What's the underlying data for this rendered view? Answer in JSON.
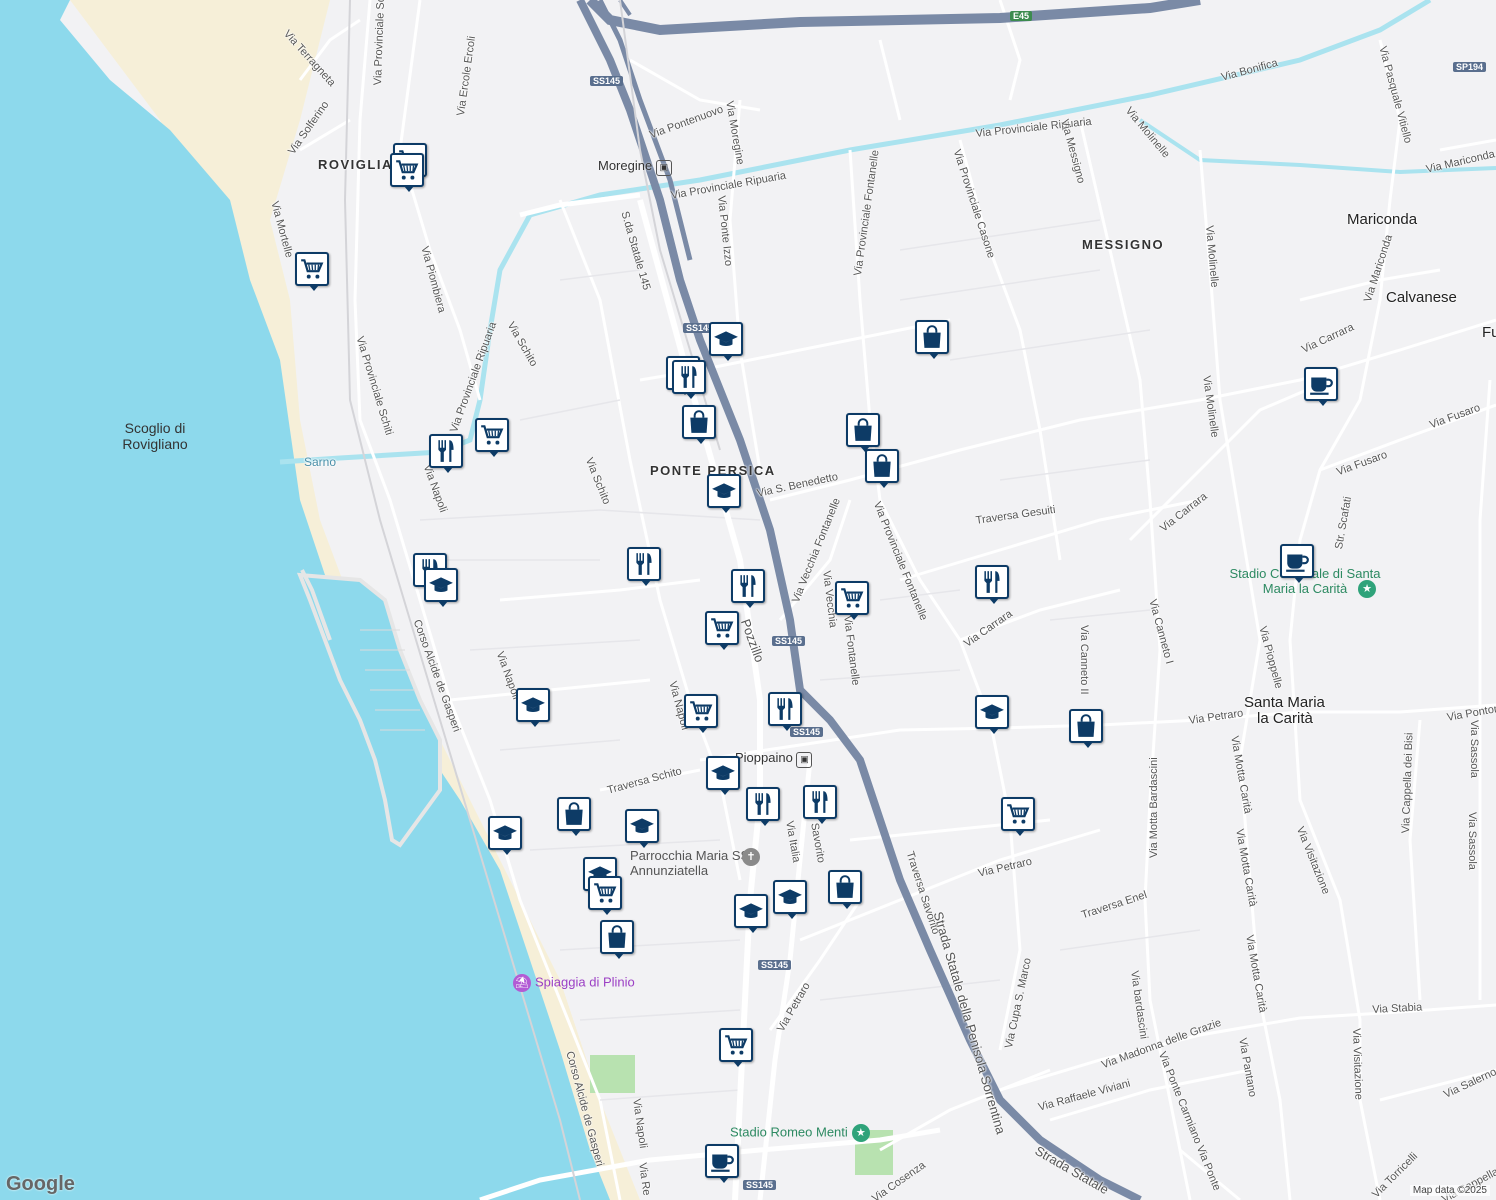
{
  "colors": {
    "sea": "#8dd9ec",
    "land": "#f2f2f4",
    "beach": "#f6efd8",
    "road_major": "#7a8aa6",
    "road_minor": "#ffffff",
    "river": "#aae3ef",
    "park": "#b8e2b0",
    "pin_border": "#0d3b66"
  },
  "labels": {
    "roads": [
      {
        "text": "Via Terragneta"
      },
      {
        "text": "Via Provinciale Schiti"
      },
      {
        "text": "Via Ercole Ercoli"
      },
      {
        "text": "Via Solferino"
      },
      {
        "text": "Via Mortelle"
      },
      {
        "text": "Via Provinciale Schiti"
      },
      {
        "text": "Via Piombiera"
      },
      {
        "text": "Via Provinciale Ripuaria"
      },
      {
        "text": "Via Schito"
      },
      {
        "text": "S.da Statale 145"
      },
      {
        "text": "Via Pontenuovo"
      },
      {
        "text": "Via Moregine"
      },
      {
        "text": "Via Ponte Izzo"
      },
      {
        "text": "Via Provinciale Ripuaria"
      },
      {
        "text": "Via Provinciale Ripuaria"
      },
      {
        "text": "Via Provinciale Fontanelle"
      },
      {
        "text": "Via Provinciale Casone"
      },
      {
        "text": "Via Messigno"
      },
      {
        "text": "Via Molinelle"
      },
      {
        "text": "Via Bonifica"
      },
      {
        "text": "Via Pasquale Vitiello"
      },
      {
        "text": "Via Mariconda"
      },
      {
        "text": "Via Molinelle"
      },
      {
        "text": "Via Molinelle"
      },
      {
        "text": "Via Mariconda"
      },
      {
        "text": "Via Carrara"
      },
      {
        "text": "Via Fusaro"
      },
      {
        "text": "Via Fusaro"
      },
      {
        "text": "Via Carrara"
      },
      {
        "text": "Via S. Benedetto"
      },
      {
        "text": "Traversa Gesuiti"
      },
      {
        "text": "Via Provinciale Fontanelle"
      },
      {
        "text": "Via Vecchia Fontanelle"
      },
      {
        "text": "Via Schito"
      },
      {
        "text": "Pozzillo"
      },
      {
        "text": "Via Carrara"
      },
      {
        "text": "Via Canneto II"
      },
      {
        "text": "Via Canneto I"
      },
      {
        "text": "Via Pioppelle"
      },
      {
        "text": "Via Napoli"
      },
      {
        "text": "Corso Alcide de Gasperi"
      },
      {
        "text": "Via Napoli"
      },
      {
        "text": "Traversa Schito"
      },
      {
        "text": "Via Petraro"
      },
      {
        "text": "Via Motta Carità"
      },
      {
        "text": "Via Motta Bardascini"
      },
      {
        "text": "Via Visitazione"
      },
      {
        "text": "Via Cappella dei Bisi"
      },
      {
        "text": "Traversa Savorito"
      },
      {
        "text": "Via Petraro"
      },
      {
        "text": "Traversa Enel"
      },
      {
        "text": "Via Cupa S. Marco"
      },
      {
        "text": "Via bardascini"
      },
      {
        "text": "Via Motta Carità"
      },
      {
        "text": "Via Motta Carità"
      },
      {
        "text": "Via Madonna delle Grazie"
      },
      {
        "text": "Via Stabia"
      },
      {
        "text": "Via Raffaele Viviani"
      },
      {
        "text": "Via Ponte Carmiano Via Ponte"
      },
      {
        "text": "Via Pantano"
      },
      {
        "text": "Via Visitazione"
      },
      {
        "text": "Via Petraro"
      },
      {
        "text": "Corso Alcide de Gasperi"
      },
      {
        "text": "Via Napoli"
      },
      {
        "text": "Strada Statale della Penisola Sorrentina"
      },
      {
        "text": "Strada Statale"
      },
      {
        "text": "Via Sassola"
      },
      {
        "text": "Via Salerno"
      },
      {
        "text": "Via Torricelli"
      },
      {
        "text": "Via Cappella dei Bisi"
      },
      {
        "text": "Via Italia"
      },
      {
        "text": "Savorito"
      },
      {
        "text": "Via Pontone"
      },
      {
        "text": "Str. Scafati"
      },
      {
        "text": "Via Sassola"
      },
      {
        "text": "Via Cosenza"
      },
      {
        "text": "Via Re"
      },
      {
        "text": "Via Napoli"
      },
      {
        "text": "Via Fontanelle"
      },
      {
        "text": "Via Vecchia"
      }
    ],
    "areas": [
      {
        "text": "ROVIGLIANO"
      },
      {
        "text": "PONTE PERSICA"
      },
      {
        "text": "MESSIGNO"
      }
    ],
    "towns": [
      {
        "text": "Mariconda"
      },
      {
        "text": "Calvanese"
      },
      {
        "text": "Santa Maria"
      },
      {
        "text": "la Carità"
      },
      {
        "text": "Fu"
      }
    ],
    "sea_label": "Scoglio di Rovigliano",
    "river": "Sarno",
    "shields": [
      {
        "text": "SS145",
        "type": "ss"
      },
      {
        "text": "SS145",
        "type": "ss"
      },
      {
        "text": "SS145",
        "type": "ss"
      },
      {
        "text": "SS145",
        "type": "ss"
      },
      {
        "text": "SS145",
        "type": "ss"
      },
      {
        "text": "SS145",
        "type": "ss"
      },
      {
        "text": "E45",
        "type": "eu"
      },
      {
        "text": "SP194",
        "type": "ss"
      }
    ],
    "stations": [
      {
        "text": "Moregine"
      },
      {
        "text": "Pioppaino"
      }
    ],
    "pois": [
      {
        "text": "Parrocchia Maria SS. Annunziatella",
        "icon": "church-icon",
        "color": "#8a8a8a"
      },
      {
        "text": "Spiaggia di Plinio",
        "icon": "beach-icon",
        "color": "#b25bd4"
      },
      {
        "text": "Stadio Comunale di Santa Maria la Carità",
        "icon": "stadium-icon",
        "color": "#2fa37a"
      },
      {
        "text": "Stadio Romeo Menti",
        "icon": "stadium-icon",
        "color": "#2fa37a"
      }
    ]
  },
  "markers": [
    {
      "type": "cart"
    },
    {
      "type": "cart"
    },
    {
      "type": "cart"
    },
    {
      "type": "school"
    },
    {
      "type": "restaurant"
    },
    {
      "type": "restaurant"
    },
    {
      "type": "shopping"
    },
    {
      "type": "shopping"
    },
    {
      "type": "restaurant"
    },
    {
      "type": "cart"
    },
    {
      "type": "shopping"
    },
    {
      "type": "shopping"
    },
    {
      "type": "school"
    },
    {
      "type": "cafe"
    },
    {
      "type": "restaurant"
    },
    {
      "type": "restaurant"
    },
    {
      "type": "cart"
    },
    {
      "type": "restaurant"
    },
    {
      "type": "cart"
    },
    {
      "type": "cafe"
    },
    {
      "type": "restaurant"
    },
    {
      "type": "school"
    },
    {
      "type": "school"
    },
    {
      "type": "cart"
    },
    {
      "type": "restaurant"
    },
    {
      "type": "school"
    },
    {
      "type": "shopping"
    },
    {
      "type": "school"
    },
    {
      "type": "restaurant"
    },
    {
      "type": "restaurant"
    },
    {
      "type": "cart"
    },
    {
      "type": "shopping"
    },
    {
      "type": "school"
    },
    {
      "type": "school"
    },
    {
      "type": "school"
    },
    {
      "type": "cart"
    },
    {
      "type": "school"
    },
    {
      "type": "shopping"
    },
    {
      "type": "shopping"
    },
    {
      "type": "school"
    },
    {
      "type": "cart"
    },
    {
      "type": "cafe"
    }
  ],
  "attribution": {
    "google": "Google",
    "copyright": "Map data ©2025"
  }
}
